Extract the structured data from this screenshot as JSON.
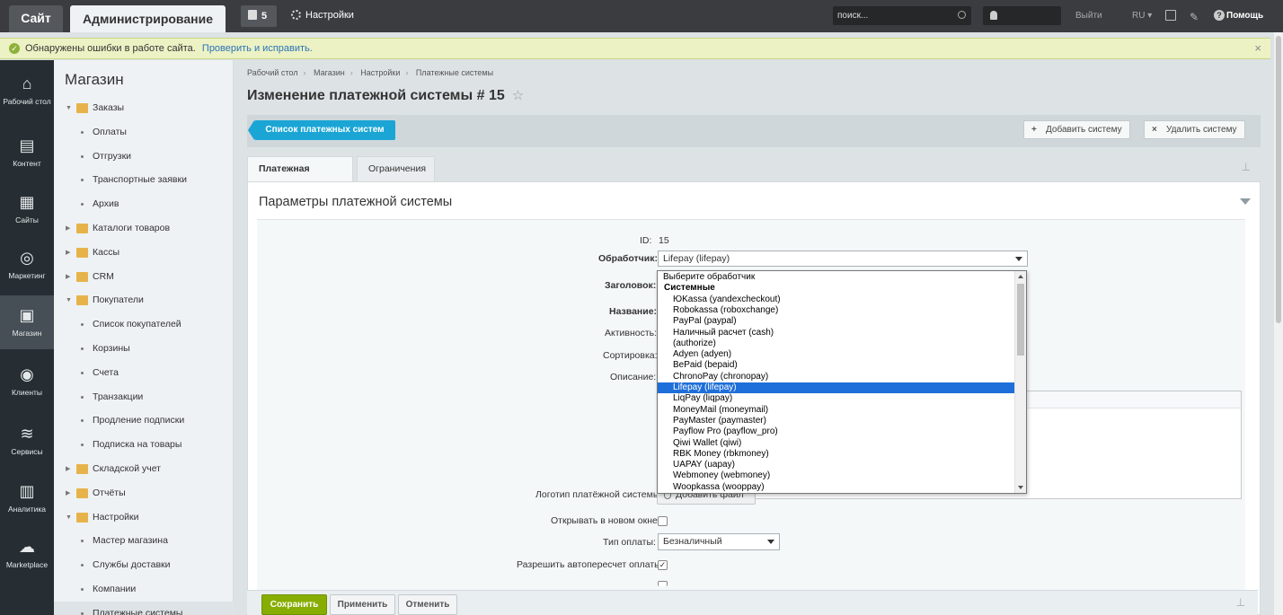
{
  "topbar": {
    "site_tab": "Сайт",
    "admin_tab": "Администрирование",
    "notifications_count": "5",
    "settings_label": "Настройки",
    "search_placeholder": "поиск...",
    "logout_label": "Выйти",
    "lang_label": "RU",
    "help_label": "Помощь"
  },
  "warning": {
    "message": "Обнаружены ошибки в работе сайта.",
    "fix_link": "Проверить и исправить."
  },
  "icon_menu": [
    {
      "label": "Рабочий стол",
      "icon": "home-icon"
    },
    {
      "label": "Контент",
      "icon": "document-icon"
    },
    {
      "label": "Сайты",
      "icon": "calendar-icon"
    },
    {
      "label": "Маркетинг",
      "icon": "target-icon"
    },
    {
      "label": "Магазин",
      "icon": "basket-icon"
    },
    {
      "label": "Клиенты",
      "icon": "clients-icon"
    },
    {
      "label": "Сервисы",
      "icon": "layers-icon"
    },
    {
      "label": "Аналитика",
      "icon": "bar-chart-icon"
    },
    {
      "label": "Marketplace",
      "icon": "cloud-download-icon"
    }
  ],
  "tree": {
    "title": "Магазин",
    "items": [
      {
        "label": "Заказы",
        "kind": "folder",
        "expanded": true
      },
      {
        "label": "Оплаты",
        "kind": "sub"
      },
      {
        "label": "Отгрузки",
        "kind": "sub"
      },
      {
        "label": "Транспортные заявки",
        "kind": "sub"
      },
      {
        "label": "Архив",
        "kind": "sub"
      },
      {
        "label": "Каталоги товаров",
        "kind": "folder",
        "expanded": false
      },
      {
        "label": "Кассы",
        "kind": "folder",
        "expanded": false
      },
      {
        "label": "CRM",
        "kind": "folder",
        "expanded": false
      },
      {
        "label": "Покупатели",
        "kind": "folder",
        "expanded": true
      },
      {
        "label": "Список покупателей",
        "kind": "sub"
      },
      {
        "label": "Корзины",
        "kind": "sub"
      },
      {
        "label": "Счета",
        "kind": "sub"
      },
      {
        "label": "Транзакции",
        "kind": "sub"
      },
      {
        "label": "Продление подписки",
        "kind": "sub"
      },
      {
        "label": "Подписка на товары",
        "kind": "sub"
      },
      {
        "label": "Складской учет",
        "kind": "folder",
        "expanded": false
      },
      {
        "label": "Отчёты",
        "kind": "folder",
        "expanded": false
      },
      {
        "label": "Настройки",
        "kind": "folder",
        "expanded": true
      },
      {
        "label": "Мастер магазина",
        "kind": "sub"
      },
      {
        "label": "Службы доставки",
        "kind": "sub"
      },
      {
        "label": "Компании",
        "kind": "sub"
      },
      {
        "label": "Платежные системы",
        "kind": "sub",
        "selected": true
      }
    ]
  },
  "breadcrumbs": [
    "Рабочий стол",
    "Магазин",
    "Настройки",
    "Платежные системы"
  ],
  "page_title": "Изменение платежной системы # 15",
  "toolbar": {
    "list_button": "Список платежных систем",
    "add_button": "Добавить систему",
    "delete_button": "Удалить систему"
  },
  "tabs": [
    "Платежная система",
    "Ограничения"
  ],
  "panel": {
    "title": "Параметры платежной системы",
    "id_label": "ID:",
    "id_value": "15",
    "handler_label": "Обработчик:",
    "handler_value": "Lifepay (lifepay)",
    "heading_label": "Заголовок:",
    "name_label": "Название:",
    "active_label": "Активность:",
    "sort_label": "Сортировка:",
    "description_label": "Описание:",
    "logo_label": "Логотип платёжной системы:",
    "add_file_button": "Добавить файл",
    "new_window_label": "Открывать в новом окне:",
    "pay_type_label": "Тип оплаты:",
    "pay_type_value": "Безналичный",
    "auto_recalc_label": "Разрешить автопересчет оплаты:"
  },
  "dropdown": {
    "options": [
      {
        "label": "Выберите обработчик",
        "kind": "top"
      },
      {
        "label": "Системные",
        "kind": "group"
      },
      {
        "label": "ЮKassa (yandexcheckout)",
        "kind": "opt"
      },
      {
        "label": "Robokassa (roboxchange)",
        "kind": "opt"
      },
      {
        "label": "PayPal (paypal)",
        "kind": "opt"
      },
      {
        "label": "Наличный расчет (cash)",
        "kind": "opt"
      },
      {
        "label": "(authorize)",
        "kind": "opt"
      },
      {
        "label": "Adyen (adyen)",
        "kind": "opt"
      },
      {
        "label": "BePaid (bepaid)",
        "kind": "opt"
      },
      {
        "label": "ChronoPay (chronopay)",
        "kind": "opt"
      },
      {
        "label": "Lifepay (lifepay)",
        "kind": "opt",
        "selected": true
      },
      {
        "label": "LiqPay (liqpay)",
        "kind": "opt"
      },
      {
        "label": "MoneyMail (moneymail)",
        "kind": "opt"
      },
      {
        "label": "PayMaster (paymaster)",
        "kind": "opt"
      },
      {
        "label": "Payflow Pro (payflow_pro)",
        "kind": "opt"
      },
      {
        "label": "Qiwi Wallet (qiwi)",
        "kind": "opt"
      },
      {
        "label": "RBK Money (rbkmoney)",
        "kind": "opt"
      },
      {
        "label": "UAPAY (uapay)",
        "kind": "opt"
      },
      {
        "label": "Webmoney (webmoney)",
        "kind": "opt"
      },
      {
        "label": "Woopkassa (wooppay)",
        "kind": "opt"
      }
    ]
  },
  "bottom": {
    "save": "Сохранить",
    "apply": "Применить",
    "cancel": "Отменить"
  },
  "colors": {
    "topbar": "#3a3c3f",
    "accent_blue": "#1aa5d5",
    "save_green": "#86ad00",
    "highlight": "#1e6fd9"
  }
}
